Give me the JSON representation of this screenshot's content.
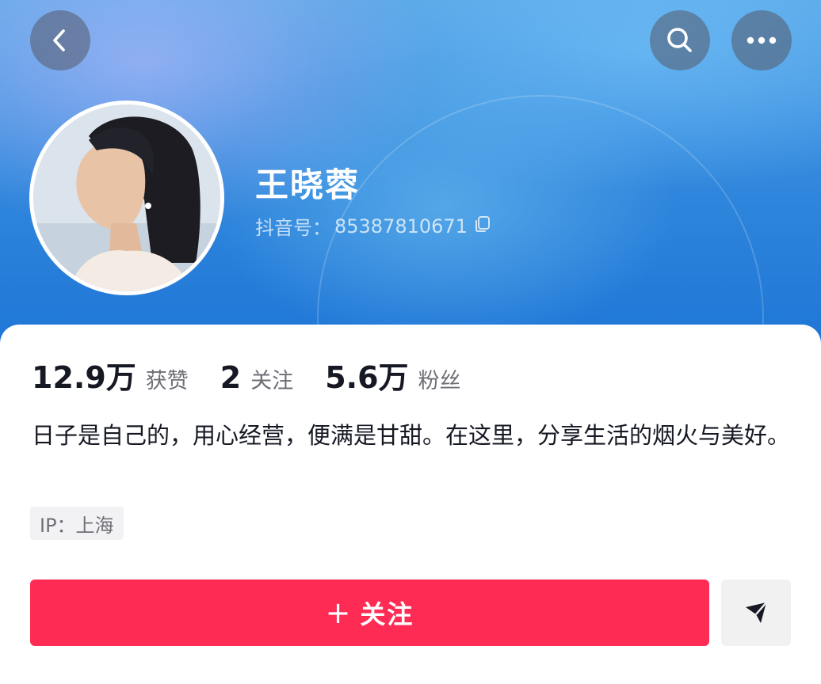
{
  "header": {
    "back_icon": "chevron-left-icon",
    "search_icon": "search-icon",
    "more_icon": "more-horizontal-icon"
  },
  "profile": {
    "name": "王晓蓉",
    "douyin_id_label": "抖音号：",
    "douyin_id": "85387810671",
    "copy_icon": "copy-icon",
    "avatar_icon": "avatar-photo"
  },
  "stats": [
    {
      "value": "12.9万",
      "label": "获赞"
    },
    {
      "value": "2",
      "label": "关注"
    },
    {
      "value": "5.6万",
      "label": "粉丝"
    }
  ],
  "bio": "日子是自己的，用心经营，便满是甘甜。在这里，分享生活的烟火与美好。",
  "ip_location": "IP：上海",
  "actions": {
    "follow_plus": "+",
    "follow_label": "关注",
    "follow_color": "#fe2c55",
    "message_icon": "send-icon"
  }
}
